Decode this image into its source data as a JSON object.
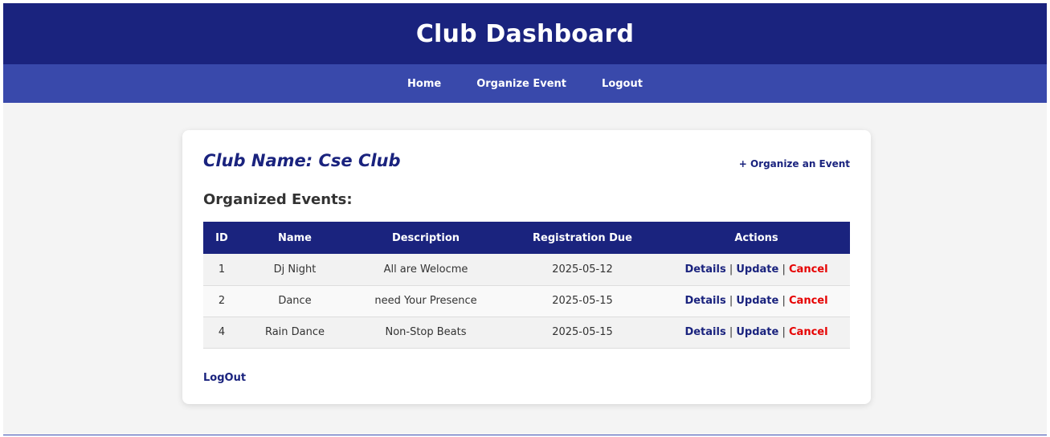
{
  "header": {
    "title": "Club Dashboard"
  },
  "nav": {
    "home": "Home",
    "organize": "Organize Event",
    "logout": "Logout"
  },
  "card": {
    "club_name": "Club Name: Cse Club",
    "organize_link": "+ Organize an Event",
    "section_title": "Organized Events:",
    "logout_link": "LogOut"
  },
  "table": {
    "headers": [
      "ID",
      "Name",
      "Description",
      "Registration Due",
      "Actions"
    ],
    "rows": [
      {
        "id": "1",
        "name": "Dj Night",
        "description": "All are Welocme",
        "due": "2025-05-12",
        "details": "Details",
        "update": "Update",
        "cancel": "Cancel"
      },
      {
        "id": "2",
        "name": "Dance",
        "description": "need Your Presence",
        "due": "2025-05-15",
        "details": "Details",
        "update": "Update",
        "cancel": "Cancel"
      },
      {
        "id": "4",
        "name": "Rain Dance",
        "description": "Non-Stop Beats",
        "due": "2025-05-15",
        "details": "Details",
        "update": "Update",
        "cancel": "Cancel"
      }
    ],
    "separator": "|"
  },
  "colors": {
    "header_bg": "#1a237e",
    "nav_bg": "#3949ab",
    "cancel": "#e60000",
    "link": "#1a237e"
  }
}
